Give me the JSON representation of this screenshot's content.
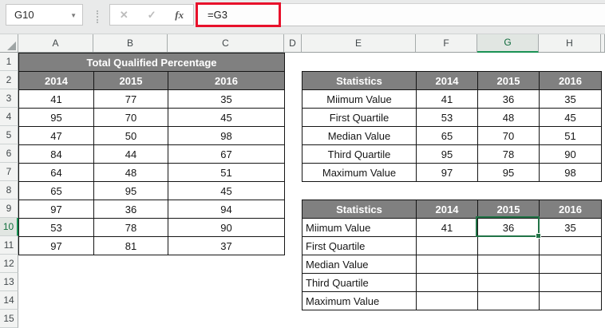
{
  "formula_bar": {
    "name_box": "G10",
    "cancel_icon": "✕",
    "enter_icon": "✓",
    "fx_label": "fx",
    "formula": "=G3"
  },
  "grid": {
    "column_headers": [
      "A",
      "B",
      "C",
      "D",
      "E",
      "F",
      "G",
      "H"
    ],
    "row_headers": [
      "1",
      "2",
      "3",
      "4",
      "5",
      "6",
      "7",
      "8",
      "9",
      "10",
      "11",
      "12",
      "13",
      "14",
      "15"
    ],
    "selected_column": "G",
    "selected_row": "10",
    "active_cell": "G10"
  },
  "left_table": {
    "title": "Total Qualified Percentage",
    "columns": [
      "2014",
      "2015",
      "2016"
    ],
    "rows": [
      [
        "41",
        "77",
        "35"
      ],
      [
        "95",
        "70",
        "45"
      ],
      [
        "47",
        "50",
        "98"
      ],
      [
        "84",
        "44",
        "67"
      ],
      [
        "64",
        "48",
        "51"
      ],
      [
        "65",
        "95",
        "45"
      ],
      [
        "97",
        "36",
        "94"
      ],
      [
        "53",
        "78",
        "90"
      ],
      [
        "97",
        "81",
        "37"
      ]
    ]
  },
  "stats_table_top": {
    "headers": [
      "Statistics",
      "2014",
      "2015",
      "2016"
    ],
    "rows": [
      [
        "Miimum Value",
        "41",
        "36",
        "35"
      ],
      [
        "First Quartile",
        "53",
        "48",
        "45"
      ],
      [
        "Median Value",
        "65",
        "70",
        "51"
      ],
      [
        "Third Quartile",
        "95",
        "78",
        "90"
      ],
      [
        "Maximum Value",
        "97",
        "95",
        "98"
      ]
    ]
  },
  "stats_table_bottom": {
    "headers": [
      "Statistics",
      "2014",
      "2015",
      "2016"
    ],
    "rows": [
      [
        "Miimum Value",
        "41",
        "36",
        "35"
      ],
      [
        "First Quartile",
        "",
        "",
        ""
      ],
      [
        "Median Value",
        "",
        "",
        ""
      ],
      [
        "Third Quartile",
        "",
        "",
        ""
      ],
      [
        "Maximum Value",
        "",
        "",
        ""
      ]
    ]
  },
  "colors": {
    "table_header_bg": "#808080",
    "selection_green": "#217346",
    "annotation_red": "#e8112b"
  }
}
